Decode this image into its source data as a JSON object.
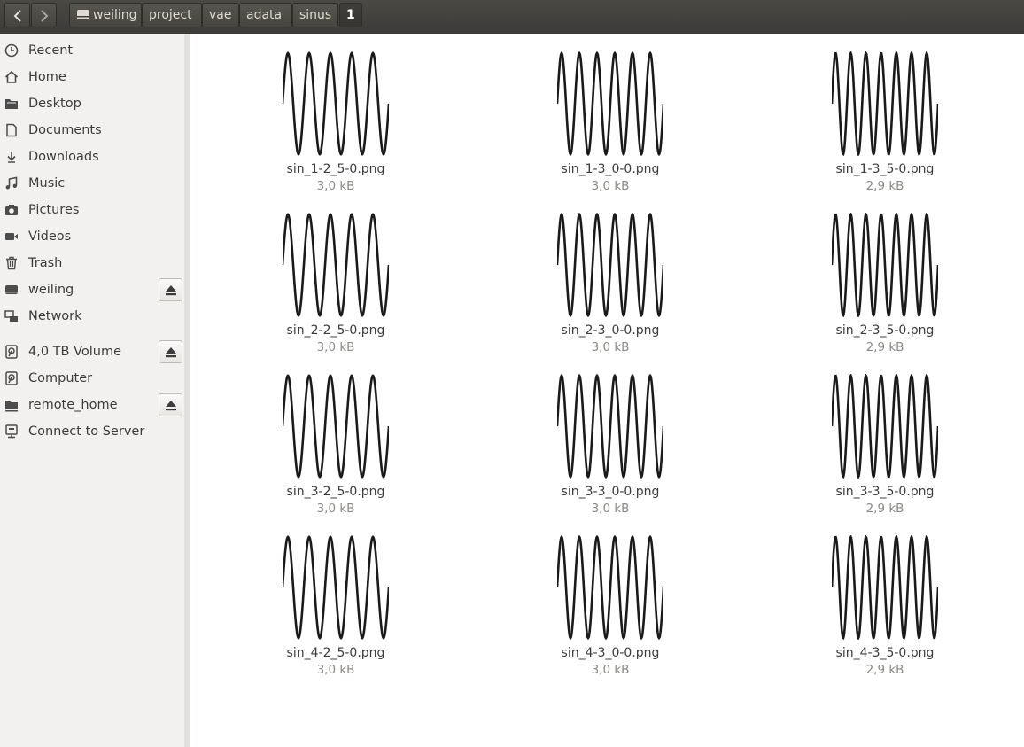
{
  "toolbar": {
    "back_icon": "chevron-left-icon",
    "forward_icon": "chevron-right-icon",
    "breadcrumb": [
      "weiling",
      "project",
      "vae",
      "adata",
      "sinus",
      "1"
    ]
  },
  "sidebar": {
    "items": [
      {
        "label": "Recent",
        "icon": "clock-icon"
      },
      {
        "label": "Home",
        "icon": "home-icon"
      },
      {
        "label": "Desktop",
        "icon": "folder-icon"
      },
      {
        "label": "Documents",
        "icon": "document-icon"
      },
      {
        "label": "Downloads",
        "icon": "download-icon"
      },
      {
        "label": "Music",
        "icon": "music-icon"
      },
      {
        "label": "Pictures",
        "icon": "camera-icon"
      },
      {
        "label": "Videos",
        "icon": "video-icon"
      },
      {
        "label": "Trash",
        "icon": "trash-icon"
      },
      {
        "label": "weiling",
        "icon": "drive-icon"
      },
      {
        "label": "Network",
        "icon": "network-icon"
      },
      {
        "label": "4,0 TB Volume",
        "icon": "disk-icon"
      },
      {
        "label": "Computer",
        "icon": "disk-icon"
      },
      {
        "label": "remote_home",
        "icon": "folder-icon"
      },
      {
        "label": "Connect to Server",
        "icon": "server-icon"
      }
    ]
  },
  "files": [
    {
      "name": "sin_1-2_5-0.png",
      "size": "3,0 kB",
      "cycles": 5
    },
    {
      "name": "sin_1-3_0-0.png",
      "size": "3,0 kB",
      "cycles": 6
    },
    {
      "name": "sin_1-3_5-0.png",
      "size": "2,9 kB",
      "cycles": 7
    },
    {
      "name": "sin_2-2_5-0.png",
      "size": "3,0 kB",
      "cycles": 5
    },
    {
      "name": "sin_2-3_0-0.png",
      "size": "3,0 kB",
      "cycles": 6
    },
    {
      "name": "sin_2-3_5-0.png",
      "size": "2,9 kB",
      "cycles": 7
    },
    {
      "name": "sin_3-2_5-0.png",
      "size": "3,0 kB",
      "cycles": 5
    },
    {
      "name": "sin_3-3_0-0.png",
      "size": "3,0 kB",
      "cycles": 6
    },
    {
      "name": "sin_3-3_5-0.png",
      "size": "2,9 kB",
      "cycles": 7
    },
    {
      "name": "sin_4-2_5-0.png",
      "size": "3,0 kB",
      "cycles": 5
    },
    {
      "name": "sin_4-3_0-0.png",
      "size": "3,0 kB",
      "cycles": 6
    },
    {
      "name": "sin_4-3_5-0.png",
      "size": "2,9 kB",
      "cycles": 7
    }
  ]
}
